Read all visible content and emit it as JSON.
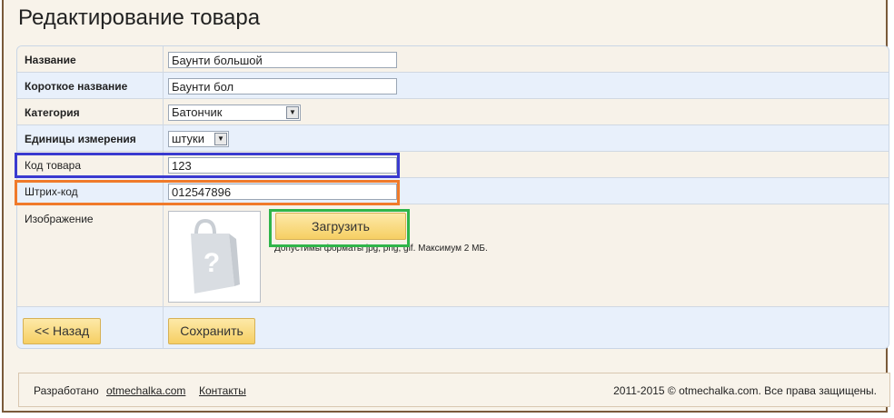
{
  "page": {
    "title": "Редактирование товара"
  },
  "form": {
    "name": {
      "label": "Название",
      "value": "Баунти большой"
    },
    "short_name": {
      "label": "Короткое название",
      "value": "Баунти бол"
    },
    "category": {
      "label": "Категория",
      "value": "Батончик"
    },
    "unit": {
      "label": "Единицы измерения",
      "value": "штуки"
    },
    "code": {
      "label": "Код товара",
      "value": "123"
    },
    "barcode": {
      "label": "Штрих-код",
      "value": "012547896"
    },
    "image": {
      "label": "Изображение",
      "upload_label": "Загрузить",
      "hint": "Допустимы форматы jpg, png, gif. Максимум 2 МБ."
    },
    "back_label": "<< Назад",
    "save_label": "Сохранить"
  },
  "highlights": {
    "code": "#3a3ad0",
    "barcode": "#f07a2a",
    "upload": "#2fb54a"
  },
  "footer": {
    "developed_by": "Разработано",
    "site_link": "otmechalka.com",
    "contacts_link": "Контакты",
    "copyright": "2011-2015 © otmechalka.com. Все права защищены."
  }
}
